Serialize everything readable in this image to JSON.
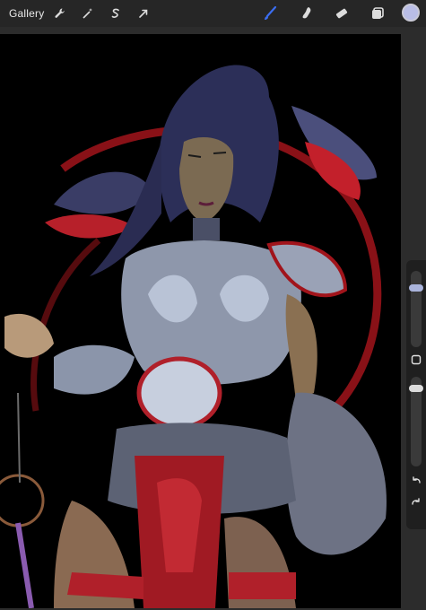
{
  "toolbar": {
    "gallery_label": "Gallery",
    "left_tools": [
      "wrench-icon",
      "magic-wand-icon",
      "selection-icon",
      "transform-arrow-icon"
    ],
    "right_tools": [
      "brush-icon",
      "smudge-icon",
      "eraser-icon",
      "layers-icon"
    ],
    "current_color": "#b9bde6"
  },
  "sidebar": {
    "brush_size": 0.8,
    "brush_opacity": 0.9,
    "buttons": [
      "modify-square-icon",
      "undo-icon",
      "redo-icon"
    ]
  },
  "colors": {
    "accent_active": "#3b6df0",
    "canvas_background": "#000000"
  }
}
